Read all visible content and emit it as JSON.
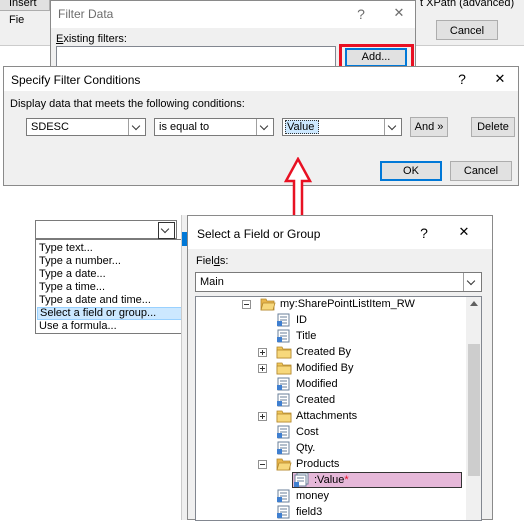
{
  "colors": {
    "accent": "#0078d7",
    "highlight_red": "#e81123",
    "selected_bg": "#cce8ff",
    "value_highlight": "#e6b8d9"
  },
  "background_window": {
    "insert_field_label": "Insert Fie",
    "xpath_label": "t XPath (advanced)",
    "cancel_label": "Cancel"
  },
  "filter_data_dialog": {
    "title": "Filter Data",
    "help": "?",
    "close": "✕",
    "existing_filters_label": "Existing filters:",
    "add_button": "Add..."
  },
  "filter_conditions_dialog": {
    "title": "Specify Filter Conditions",
    "help": "?",
    "close": "✕",
    "instructions": "Display data that meets the following conditions:",
    "field_value": "SDESC",
    "operator_value": "is equal to",
    "value_value": "Value",
    "and_button": "And »",
    "delete_button": "Delete",
    "ok_button": "OK",
    "cancel_button": "Cancel"
  },
  "value_dropdown": {
    "items": [
      "Type text...",
      "Type a number...",
      "Type a date...",
      "Type a time...",
      "Type a date and time...",
      "Select a field or group...",
      "Use a formula..."
    ],
    "selected_index": 5
  },
  "select_field_dialog": {
    "title": "Select a Field or Group",
    "help": "?",
    "close": "✕",
    "fields_label": "Fields:",
    "datasource": "Main",
    "tree": [
      {
        "label": "my:SharePointListItem_RW",
        "level": 0,
        "icon": "folder-open-icon",
        "expander": "minus"
      },
      {
        "label": "ID",
        "level": 1,
        "icon": "field-icon",
        "expander": ""
      },
      {
        "label": "Title",
        "level": 1,
        "icon": "field-icon",
        "expander": ""
      },
      {
        "label": "Created By",
        "level": 1,
        "icon": "folder-icon",
        "expander": "plus"
      },
      {
        "label": "Modified By",
        "level": 1,
        "icon": "folder-icon",
        "expander": "plus"
      },
      {
        "label": "Modified",
        "level": 1,
        "icon": "field-icon",
        "expander": ""
      },
      {
        "label": "Created",
        "level": 1,
        "icon": "field-icon",
        "expander": ""
      },
      {
        "label": "Attachments",
        "level": 1,
        "icon": "folder-icon",
        "expander": "plus"
      },
      {
        "label": "Cost",
        "level": 1,
        "icon": "field-icon",
        "expander": ""
      },
      {
        "label": "Qty.",
        "level": 1,
        "icon": "field-icon",
        "expander": ""
      },
      {
        "label": "Products",
        "level": 1,
        "icon": "folder-open-icon",
        "expander": "minus"
      },
      {
        "label": ":Value",
        "level": 2,
        "icon": "repeating-field-icon",
        "expander": "",
        "suffix": "*",
        "selected": true
      },
      {
        "label": "money",
        "level": 1,
        "icon": "field-icon",
        "expander": ""
      },
      {
        "label": "field3",
        "level": 1,
        "icon": "field-icon",
        "expander": ""
      }
    ]
  }
}
